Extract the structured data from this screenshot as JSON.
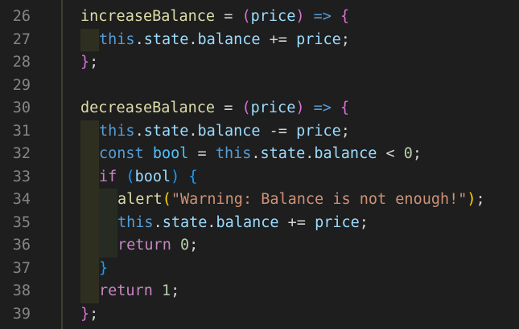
{
  "editor": {
    "line_numbers": [
      "26",
      "27",
      "28",
      "29",
      "30",
      "31",
      "32",
      "33",
      "34",
      "35",
      "36",
      "37",
      "38",
      "39"
    ],
    "lines": [
      [
        {
          "t": "increaseBalance",
          "c": "fn"
        },
        {
          "t": " = ",
          "c": "op"
        },
        {
          "t": "(",
          "c": "paren2"
        },
        {
          "t": "price",
          "c": "var"
        },
        {
          "t": ")",
          "c": "paren2"
        },
        {
          "t": " ",
          "c": "op"
        },
        {
          "t": "=>",
          "c": "kw"
        },
        {
          "t": " ",
          "c": "op"
        },
        {
          "t": "{",
          "c": "paren2"
        }
      ],
      [
        {
          "t": "this",
          "c": "kw"
        },
        {
          "t": ".",
          "c": "op"
        },
        {
          "t": "state",
          "c": "var"
        },
        {
          "t": ".",
          "c": "op"
        },
        {
          "t": "balance",
          "c": "var"
        },
        {
          "t": " += ",
          "c": "op"
        },
        {
          "t": "price",
          "c": "var"
        },
        {
          "t": ";",
          "c": "op"
        }
      ],
      [
        {
          "t": "}",
          "c": "paren2"
        },
        {
          "t": ";",
          "c": "op"
        }
      ],
      [],
      [
        {
          "t": "decreaseBalance",
          "c": "fn"
        },
        {
          "t": " = ",
          "c": "op"
        },
        {
          "t": "(",
          "c": "paren2"
        },
        {
          "t": "price",
          "c": "var"
        },
        {
          "t": ")",
          "c": "paren2"
        },
        {
          "t": " ",
          "c": "op"
        },
        {
          "t": "=>",
          "c": "kw"
        },
        {
          "t": " ",
          "c": "op"
        },
        {
          "t": "{",
          "c": "paren2"
        }
      ],
      [
        {
          "t": "this",
          "c": "kw"
        },
        {
          "t": ".",
          "c": "op"
        },
        {
          "t": "state",
          "c": "var"
        },
        {
          "t": ".",
          "c": "op"
        },
        {
          "t": "balance",
          "c": "var"
        },
        {
          "t": " -= ",
          "c": "op"
        },
        {
          "t": "price",
          "c": "var"
        },
        {
          "t": ";",
          "c": "op"
        }
      ],
      [
        {
          "t": "const",
          "c": "kw"
        },
        {
          "t": " ",
          "c": "op"
        },
        {
          "t": "bool",
          "c": "const"
        },
        {
          "t": " = ",
          "c": "op"
        },
        {
          "t": "this",
          "c": "kw"
        },
        {
          "t": ".",
          "c": "op"
        },
        {
          "t": "state",
          "c": "var"
        },
        {
          "t": ".",
          "c": "op"
        },
        {
          "t": "balance",
          "c": "var"
        },
        {
          "t": " < ",
          "c": "op"
        },
        {
          "t": "0",
          "c": "num"
        },
        {
          "t": ";",
          "c": "op"
        }
      ],
      [
        {
          "t": "if",
          "c": "ctrl"
        },
        {
          "t": " ",
          "c": "op"
        },
        {
          "t": "(",
          "c": "paren3"
        },
        {
          "t": "bool",
          "c": "var"
        },
        {
          "t": ")",
          "c": "paren3"
        },
        {
          "t": " ",
          "c": "op"
        },
        {
          "t": "{",
          "c": "paren3"
        }
      ],
      [
        {
          "t": "alert",
          "c": "fn"
        },
        {
          "t": "(",
          "c": "paren1"
        },
        {
          "t": "\"Warning: Balance is not enough!\"",
          "c": "str"
        },
        {
          "t": ")",
          "c": "paren1"
        },
        {
          "t": ";",
          "c": "op"
        }
      ],
      [
        {
          "t": "this",
          "c": "kw"
        },
        {
          "t": ".",
          "c": "op"
        },
        {
          "t": "state",
          "c": "var"
        },
        {
          "t": ".",
          "c": "op"
        },
        {
          "t": "balance",
          "c": "var"
        },
        {
          "t": " += ",
          "c": "op"
        },
        {
          "t": "price",
          "c": "var"
        },
        {
          "t": ";",
          "c": "op"
        }
      ],
      [
        {
          "t": "return",
          "c": "ctrl"
        },
        {
          "t": " ",
          "c": "op"
        },
        {
          "t": "0",
          "c": "num"
        },
        {
          "t": ";",
          "c": "op"
        }
      ],
      [
        {
          "t": "}",
          "c": "paren3"
        }
      ],
      [
        {
          "t": "return",
          "c": "ctrl"
        },
        {
          "t": " ",
          "c": "op"
        },
        {
          "t": "1",
          "c": "num"
        },
        {
          "t": ";",
          "c": "op"
        }
      ],
      [
        {
          "t": "}",
          "c": "paren2"
        },
        {
          "t": ";",
          "c": "op"
        }
      ]
    ],
    "indent_levels": [
      0,
      1,
      0,
      0,
      0,
      1,
      1,
      1,
      2,
      2,
      2,
      1,
      1,
      0
    ],
    "colors": {
      "background": "#1e1e1e",
      "line_number": "#858585",
      "function": "#dcdcaa",
      "variable": "#9cdcfe",
      "constant": "#4fc1ff",
      "keyword": "#569cd6",
      "control": "#c586c0",
      "number": "#b5cea8",
      "string": "#ce9178"
    }
  }
}
